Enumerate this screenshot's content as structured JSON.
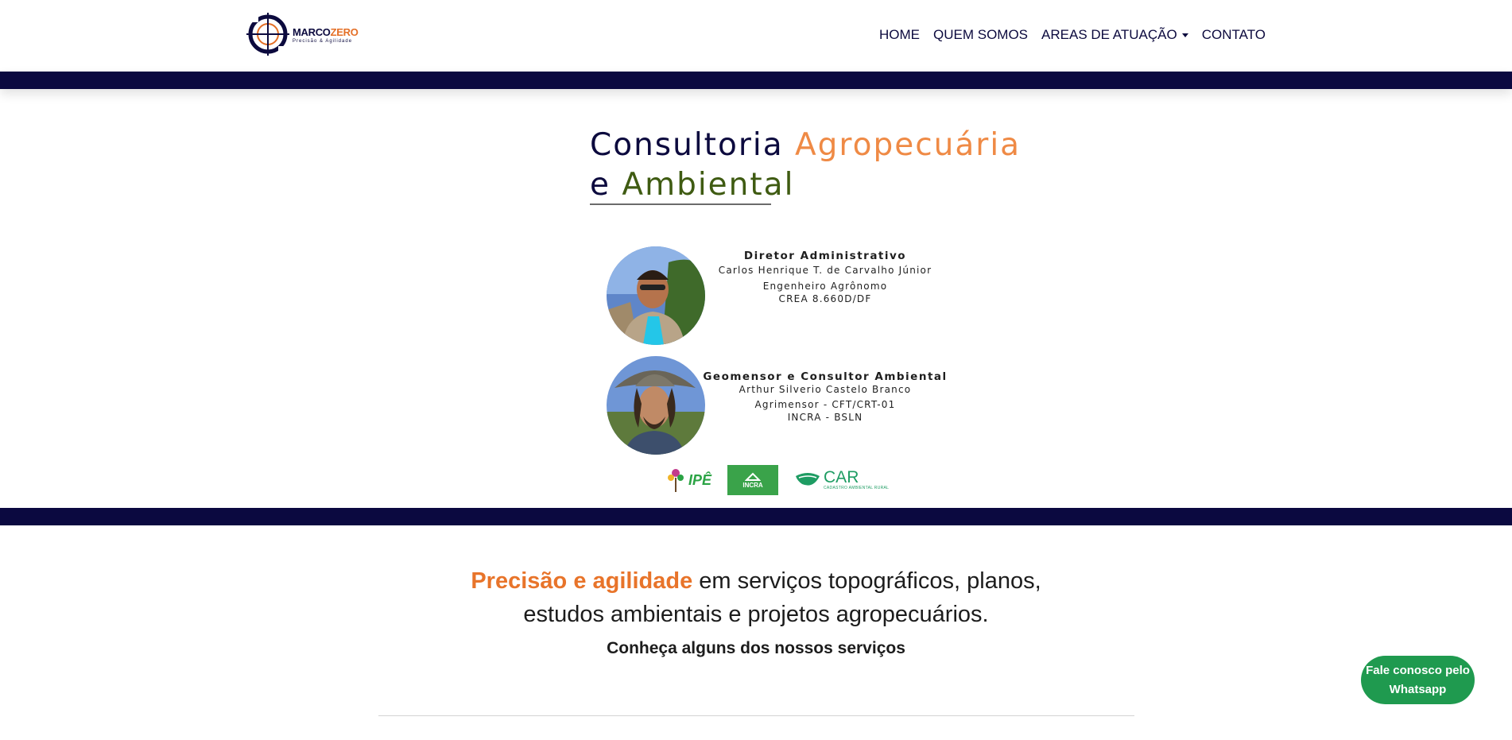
{
  "header": {
    "logo": {
      "name_part1": "MARCO",
      "name_part2": "ZERO",
      "tagline": "Precisão & Agilidade"
    },
    "nav": [
      {
        "label": "HOME"
      },
      {
        "label": "QUEM SOMOS"
      },
      {
        "label": "AREAS DE ATUAÇÃO",
        "has_dropdown": true
      },
      {
        "label": "CONTATO"
      }
    ]
  },
  "hero": {
    "title_part1": "Consultoria ",
    "title_part2": "Agropecuária",
    "title_part3": "e ",
    "title_part4": "Ambiental",
    "people": [
      {
        "role": "Diretor Administrativo",
        "name": "Carlos Henrique T. de Carvalho Júnior",
        "title": "Engenheiro Agrônomo",
        "registry": "CREA 8.660D/DF"
      },
      {
        "role": "Geomensor e Consultor Ambiental",
        "name": "Arthur Silverio Castelo Branco",
        "title": "Agrimensor - CFT/CRT-01",
        "registry": "INCRA - BSLN"
      }
    ],
    "badges": {
      "ipe": "IPÊ",
      "incra": "INCRA",
      "car": "CAR",
      "car_sub": "CADASTRO AMBIENTAL RURAL"
    }
  },
  "intro": {
    "highlight": "Precisão e agilidade",
    "rest_line1": " em serviços topográficos, planos,",
    "line2": "estudos ambientais e projetos agropecuários.",
    "services_heading": "Conheça alguns dos nossos serviços"
  },
  "whatsapp": {
    "line1": "Fale conosco pelo",
    "line2": "Whatsapp"
  },
  "colors": {
    "navy": "#0c0a3e",
    "orange": "#e8742a",
    "green": "#3f5b12",
    "whatsapp": "#1f9a4f"
  }
}
